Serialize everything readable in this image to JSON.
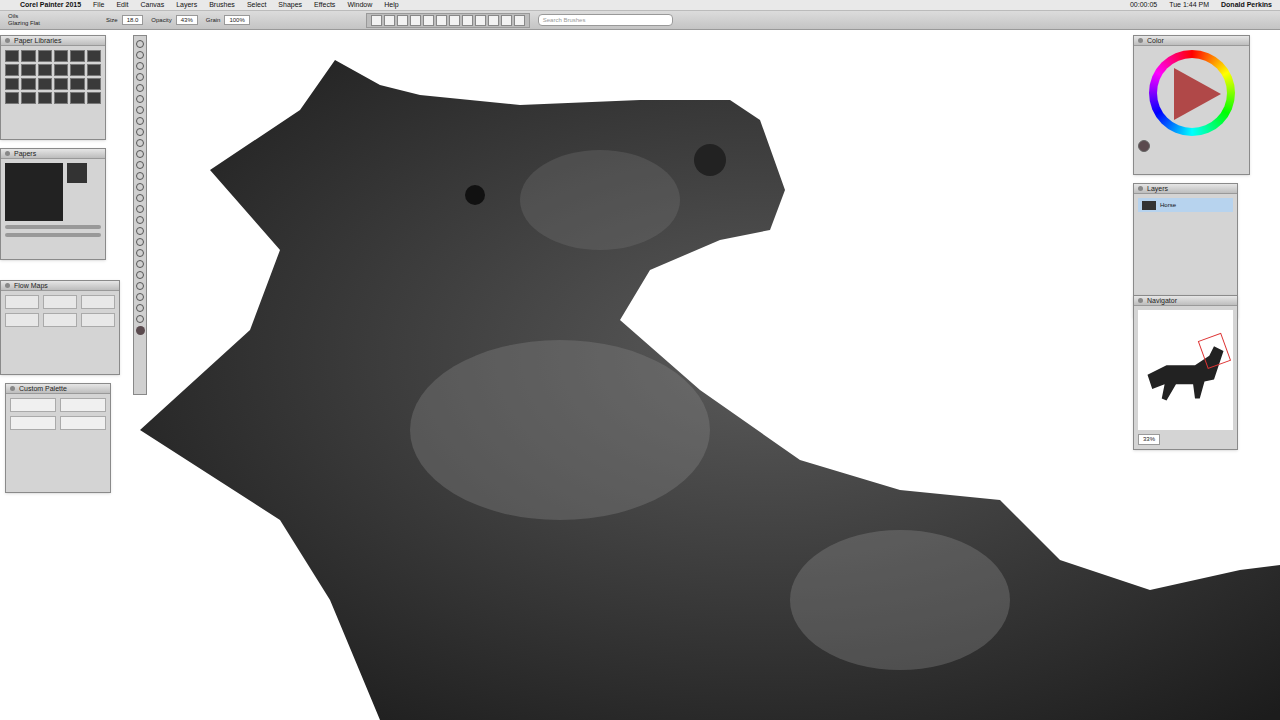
{
  "menubar": {
    "apple": "",
    "app": "Corel Painter 2015",
    "menus": [
      "File",
      "Edit",
      "Canvas",
      "Layers",
      "Brushes",
      "Select",
      "Shapes",
      "Effects",
      "Window",
      "Help"
    ],
    "timer": "00:00:05",
    "clock": "Tue 1:44 PM",
    "user": "Donald Perkins"
  },
  "property_bar": {
    "brush_category": "Oils",
    "brush_variant": "Glazing Flat",
    "fields": [
      {
        "label": "Size",
        "value": "18.0"
      },
      {
        "label": "Opacity",
        "value": "43%"
      },
      {
        "label": "Grain",
        "value": "100%"
      }
    ],
    "search": {
      "placeholder": "Search Brushes"
    }
  },
  "left_panels": [
    {
      "title": "Paper Libraries"
    },
    {
      "title": "Papers"
    },
    {
      "title": "Flow Maps"
    },
    {
      "title": "Custom Palette"
    }
  ],
  "color_panel": {
    "title": "Color",
    "current_color": "#5a4a4e"
  },
  "layers_panel": {
    "title": "Layers",
    "layers": [
      {
        "name": "Horse",
        "selected": true
      }
    ]
  },
  "navigator_panel": {
    "title": "Navigator",
    "zoom": "33%"
  }
}
